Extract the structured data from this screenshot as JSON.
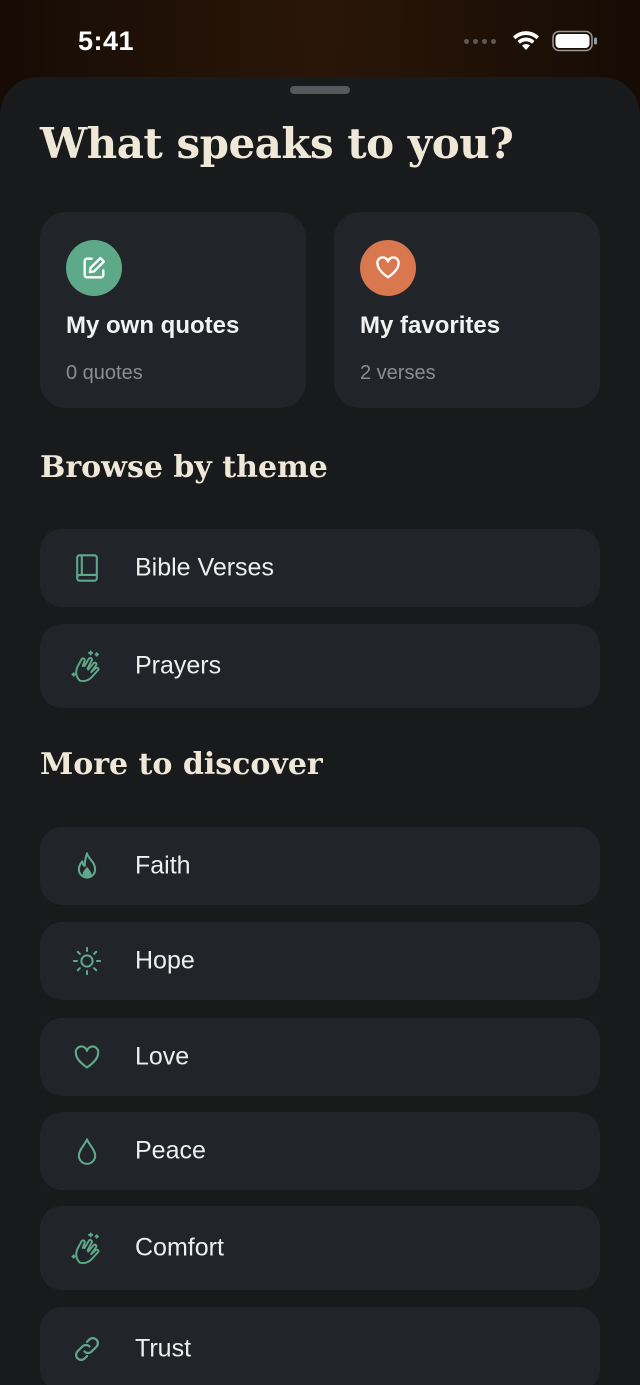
{
  "status_bar": {
    "time": "5:41"
  },
  "page_title": "What speaks to you?",
  "cards": [
    {
      "title": "My own quotes",
      "subtitle": "0 quotes",
      "icon": "edit-icon",
      "color": "#5ea98a"
    },
    {
      "title": "My favorites",
      "subtitle": "2 verses",
      "icon": "heart-icon",
      "color": "#d9774f"
    }
  ],
  "browse": {
    "heading": "Browse by theme",
    "items": [
      {
        "label": "Bible Verses",
        "icon": "book-icon"
      },
      {
        "label": "Prayers",
        "icon": "praying-hands-icon"
      }
    ]
  },
  "discover": {
    "heading": "More to discover",
    "items": [
      {
        "label": "Faith",
        "icon": "flame-icon"
      },
      {
        "label": "Hope",
        "icon": "sun-icon"
      },
      {
        "label": "Love",
        "icon": "heart-icon"
      },
      {
        "label": "Peace",
        "icon": "droplet-icon"
      },
      {
        "label": "Comfort",
        "icon": "praying-hands-icon"
      },
      {
        "label": "Trust",
        "icon": "link-icon"
      }
    ]
  },
  "colors": {
    "accent": "#5ea98a",
    "favorite": "#d9774f",
    "background": "#181a1c",
    "row": "#212428"
  }
}
